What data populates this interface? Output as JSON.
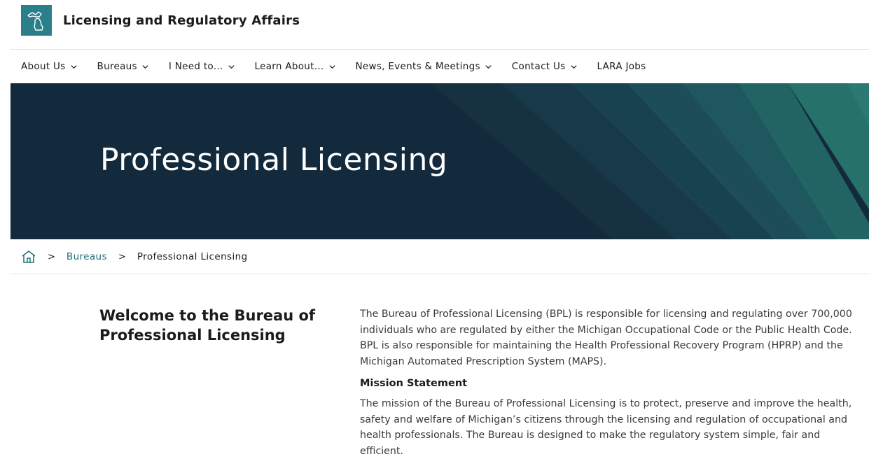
{
  "header": {
    "site_title": "Licensing and Regulatory Affairs",
    "logo_icon": "michigan-state-outline-icon",
    "brand_color": "#2a7f8a"
  },
  "nav": {
    "items": [
      {
        "label": "About Us",
        "has_dropdown": true
      },
      {
        "label": "Bureaus",
        "has_dropdown": true
      },
      {
        "label": "I Need to...",
        "has_dropdown": true
      },
      {
        "label": "Learn About...",
        "has_dropdown": true
      },
      {
        "label": "News, Events & Meetings",
        "has_dropdown": true
      },
      {
        "label": "Contact Us",
        "has_dropdown": true
      },
      {
        "label": "LARA Jobs",
        "has_dropdown": false
      }
    ]
  },
  "hero": {
    "title": "Professional Licensing",
    "background_color": "#132a3d",
    "accent_color": "#2a7a72"
  },
  "breadcrumb": {
    "home_icon": "home-icon",
    "separator": ">",
    "items": [
      {
        "label": "Bureaus",
        "link": true
      },
      {
        "label": "Professional Licensing",
        "link": false
      }
    ],
    "link_color": "#1d6f78"
  },
  "main": {
    "welcome_heading": "Welcome to the Bureau of Professional Licensing",
    "intro": "The Bureau of Professional Licensing (BPL) is responsible for licensing and regulating over 700,000 individuals who are regulated by either the Michigan Occupational Code or the Public Health Code. BPL is also responsible for maintaining the Health Professional Recovery Program (HPRP) and the Michigan Automated Prescription System (MAPS).",
    "mission_heading": "Mission Statement",
    "mission_text": "The mission of the Bureau of Professional Licensing is to protect, preserve and improve the health, safety and welfare of Michigan’s citizens through the licensing and regulation of occupational and health professionals. The Bureau is designed to make the regulatory system simple, fair and efficient."
  }
}
